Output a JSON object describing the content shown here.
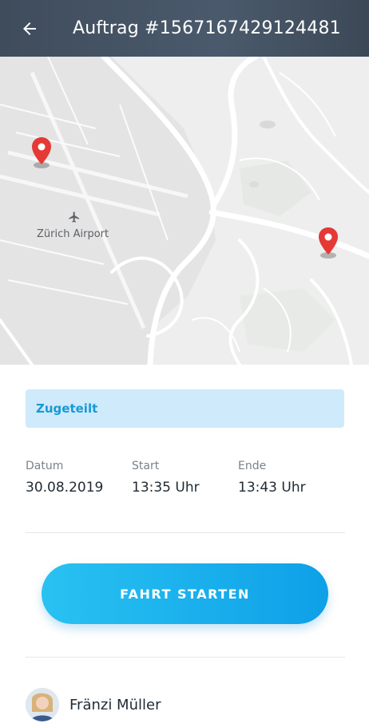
{
  "header": {
    "title": "Auftrag #1567167429124481",
    "back_icon": "arrow-left-icon"
  },
  "map": {
    "place_label": "Zürich Airport",
    "pin_color": "#e53935",
    "pins": [
      "pickup",
      "dropoff"
    ]
  },
  "status": {
    "label": "Zugeteilt",
    "text_color": "#1899d6",
    "background": "#cfeafa"
  },
  "details": {
    "date_label": "Datum",
    "date_value": "30.08.2019",
    "start_label": "Start",
    "start_value": "13:35 Uhr",
    "end_label": "Ende",
    "end_value": "13:43 Uhr"
  },
  "action": {
    "start_label": "FAHRT STARTEN",
    "accent": "#18b0ec"
  },
  "contact": {
    "name": "Fränzi Müller"
  }
}
